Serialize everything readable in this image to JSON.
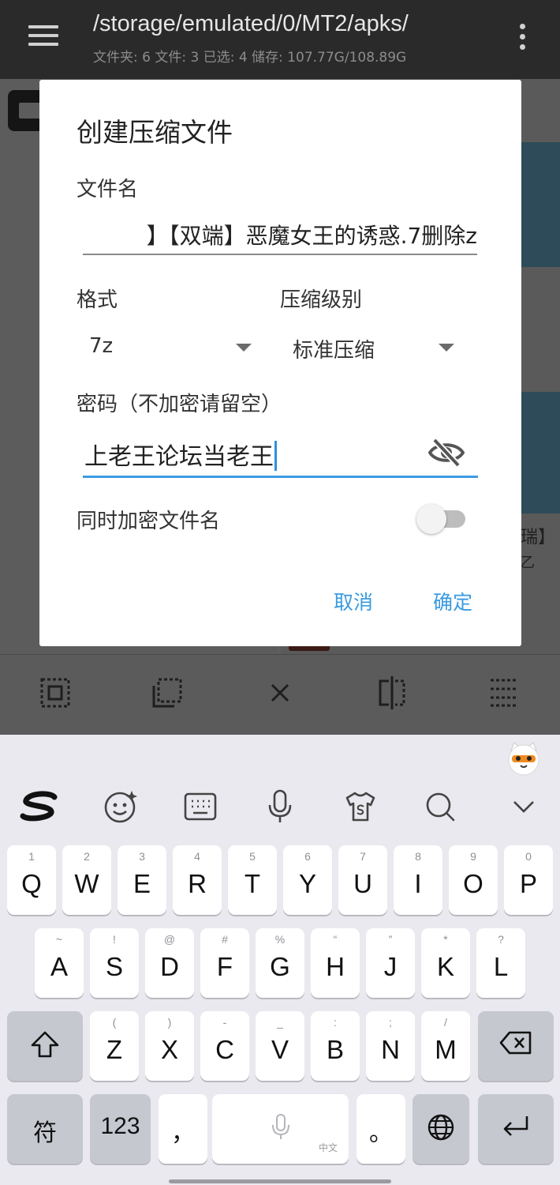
{
  "appbar": {
    "path": "/storage/emulated/0/MT2/apks/",
    "summary": "文件夹: 6  文件: 3  已选: 4  储存: 107.77G/108.89G"
  },
  "background": {
    "fragments": [
      "瑞】",
      "乙"
    ]
  },
  "dialog": {
    "title": "创建压缩文件",
    "filename_label": "文件名",
    "filename_value": "】【双端】恶魔女王的诱惑.7删除z",
    "format_label": "格式",
    "format_value": "7z",
    "level_label": "压缩级别",
    "level_value": "标准压缩",
    "password_label": "密码（不加密请留空）",
    "password_value": "上老王论坛当老王",
    "encrypt_names_label": "同时加密文件名",
    "encrypt_names_on": false,
    "cancel_label": "取消",
    "confirm_label": "确定",
    "accent_color": "#3b9be0"
  },
  "toolbar": {
    "icons": [
      "select-all-icon",
      "select-inverse-icon",
      "close-icon",
      "select-range-icon",
      "list-select-icon"
    ]
  },
  "keyboard": {
    "row1": [
      {
        "main": "Q",
        "sub": "1"
      },
      {
        "main": "W",
        "sub": "2"
      },
      {
        "main": "E",
        "sub": "3"
      },
      {
        "main": "R",
        "sub": "4"
      },
      {
        "main": "T",
        "sub": "5"
      },
      {
        "main": "Y",
        "sub": "6"
      },
      {
        "main": "U",
        "sub": "7"
      },
      {
        "main": "I",
        "sub": "8"
      },
      {
        "main": "O",
        "sub": "9"
      },
      {
        "main": "P",
        "sub": "0"
      }
    ],
    "row2": [
      {
        "main": "A",
        "sub": "~"
      },
      {
        "main": "S",
        "sub": "!"
      },
      {
        "main": "D",
        "sub": "@"
      },
      {
        "main": "F",
        "sub": "#"
      },
      {
        "main": "G",
        "sub": "%"
      },
      {
        "main": "H",
        "sub": "“"
      },
      {
        "main": "J",
        "sub": "”"
      },
      {
        "main": "K",
        "sub": "*"
      },
      {
        "main": "L",
        "sub": "?"
      }
    ],
    "row3": [
      {
        "main": "Z",
        "sub": "("
      },
      {
        "main": "X",
        "sub": ")"
      },
      {
        "main": "C",
        "sub": "-"
      },
      {
        "main": "V",
        "sub": "_"
      },
      {
        "main": "B",
        "sub": ":"
      },
      {
        "main": "N",
        "sub": ";"
      },
      {
        "main": "M",
        "sub": "/"
      }
    ],
    "symbols_label": "符",
    "numbers_label": "123",
    "comma_label": "，",
    "space_hint": "中文",
    "period_label": "。"
  }
}
